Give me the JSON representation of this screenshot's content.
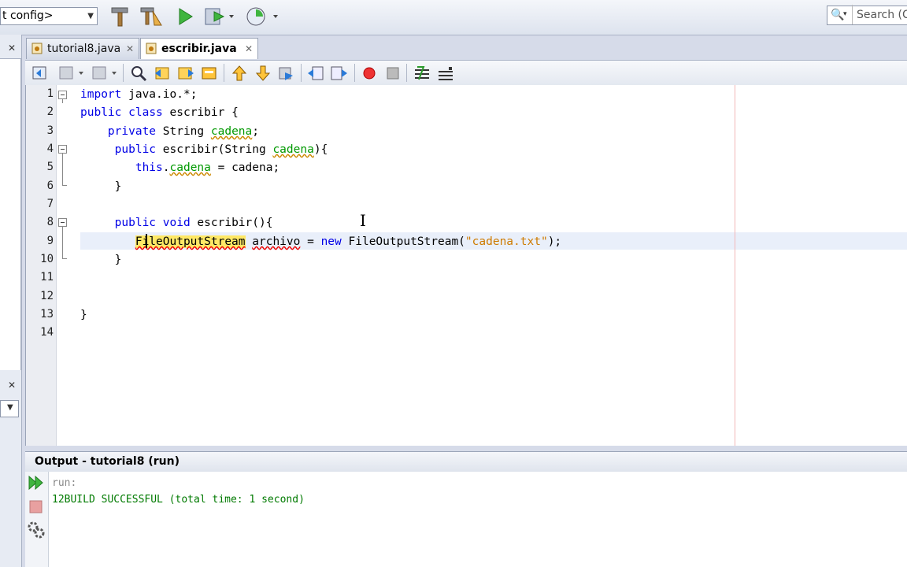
{
  "toolbar": {
    "config_value": "t config>",
    "search_placeholder": "Search (C",
    "icons": [
      "hammer-icon",
      "clean-build-icon",
      "run-icon",
      "debug-icon",
      "profile-icon"
    ]
  },
  "tabs": [
    {
      "label": "tutorial8.java",
      "active": false
    },
    {
      "label": "escribir.java",
      "active": true
    }
  ],
  "editor": {
    "line_numbers": [
      "1",
      "2",
      "3",
      "4",
      "5",
      "6",
      "7",
      "8",
      "9",
      "10",
      "11",
      "12",
      "13",
      "14"
    ],
    "lines": [
      "import java.io.*;",
      "public class escribir {",
      "    private String cadena;",
      "     public escribir(String cadena){",
      "        this.cadena = cadena;",
      "     }",
      "",
      "     public void escribir(){",
      "        FileOutputStream archivo = new FileOutputStream(\"cadena.txt\");",
      "     }",
      "",
      "",
      "}",
      ""
    ],
    "current_line": 9
  },
  "output": {
    "title": "Output - tutorial8 (run)",
    "lines": [
      "run:",
      "12BUILD SUCCESSFUL (total time: 1 second)"
    ]
  },
  "colors": {
    "keyword": "#0000e6",
    "field": "#009900",
    "string": "#ce7b00",
    "highlight": "#ffe866",
    "output_success": "#007a00"
  }
}
